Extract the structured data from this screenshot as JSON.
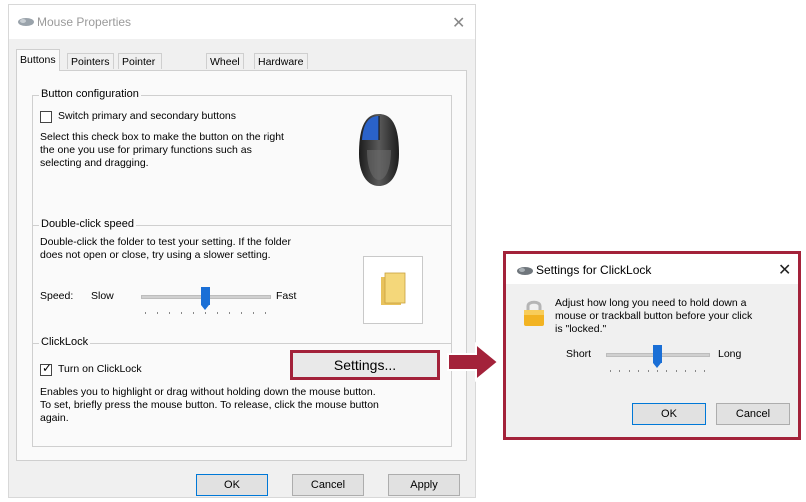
{
  "mouse_properties": {
    "title": "Mouse Properties",
    "close_glyph": "✕",
    "tabs": [
      {
        "label": "Buttons"
      },
      {
        "label": "Pointers"
      },
      {
        "label": "Pointer Options"
      },
      {
        "label": "Wheel"
      },
      {
        "label": "Hardware"
      }
    ],
    "button_configuration": {
      "label": "Button configuration",
      "checkbox_label": "Switch primary and secondary buttons",
      "checked": false,
      "description_lines": [
        "Select this check box to make the button on the right",
        "the one you use for primary functions such as",
        "selecting and dragging."
      ]
    },
    "double_click_speed": {
      "label": "Double-click speed",
      "description_lines": [
        "Double-click the folder to test your setting. If the folder",
        "does not open or close, try using a slower setting."
      ],
      "speed_label": "Speed:",
      "slow_label": "Slow",
      "fast_label": "Fast",
      "slider_value_percent": 50
    },
    "clicklock": {
      "label": "ClickLock",
      "checkbox_label": "Turn on ClickLock",
      "checked": true,
      "settings_button": "Settings...",
      "description_lines": [
        "Enables you to highlight or drag without holding down the mouse button.",
        "To set, briefly press the mouse button. To release, click the mouse button",
        "again."
      ]
    },
    "buttons": {
      "ok": "OK",
      "cancel": "Cancel",
      "apply": "Apply"
    }
  },
  "clicklock_settings": {
    "title": "Settings for ClickLock",
    "close_glyph": "✕",
    "description_lines": [
      "Adjust how long you need to hold down a",
      "mouse or trackball button before your click",
      "is \"locked.\""
    ],
    "short_label": "Short",
    "long_label": "Long",
    "slider_value_percent": 50,
    "ok": "OK",
    "cancel": "Cancel"
  },
  "colors": {
    "highlight_border": "#a3223a",
    "slider_thumb": "#1a6fd6"
  }
}
